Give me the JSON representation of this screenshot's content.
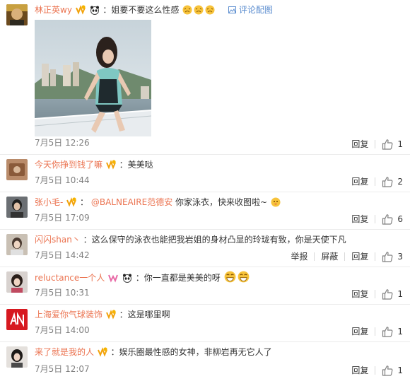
{
  "comments": [
    {
      "user": "林正英wy",
      "text": "：姐要不要这么性感",
      "pic_link": "评论配图",
      "time": "7月5日 12:26",
      "reply": "回复",
      "likes": "1"
    },
    {
      "user": "今天你挣到钱了嘛",
      "text": "：美美哒",
      "time": "7月5日 10:44",
      "reply": "回复",
      "likes": "2"
    },
    {
      "user": "张小毛-",
      "text_pre": "：",
      "mention": "@BALNEAIRE范德安",
      "text": " 你家泳衣，快来收图啦~",
      "time": "7月5日 17:09",
      "reply": "回复",
      "likes": "6"
    },
    {
      "user": "闪闪shan丶",
      "text": "：这么保守的泳衣也能把我岩姐的身材凸显的玲珑有致，你是天使下凡",
      "time": "7月5日 14:42",
      "report": "举报",
      "block": "屏蔽",
      "reply": "回复",
      "likes": "3"
    },
    {
      "user": "reluctance一个人",
      "text": "：你一直都是美美的呀",
      "time": "7月5日 10:31",
      "reply": "回复",
      "likes": "1"
    },
    {
      "user": "上海爱你气球装饰",
      "text": "：这是哪里啊",
      "time": "7月5日 14:00",
      "reply": "回复",
      "likes": "1"
    },
    {
      "user": "来了就是我的人",
      "text": "：娱乐圈最性感的女神，非柳岩再无它人了",
      "time": "7月5日 12:07",
      "reply": "回复",
      "likes": "1"
    }
  ]
}
